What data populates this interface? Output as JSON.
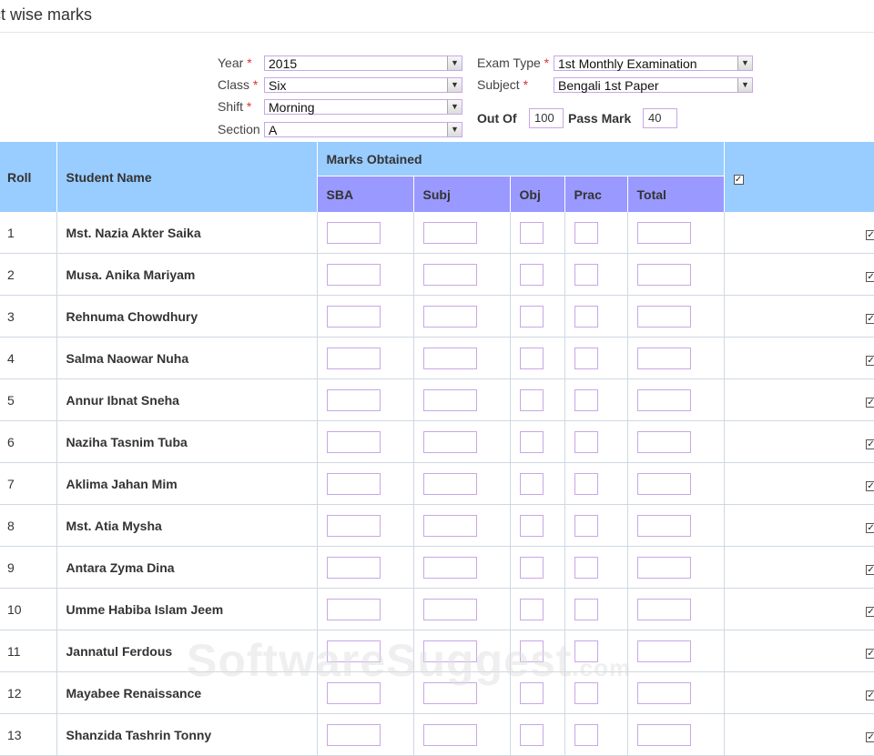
{
  "page": {
    "title": "ct wise marks"
  },
  "filters": {
    "year": {
      "label": "Year",
      "required": "*",
      "value": "2015"
    },
    "class": {
      "label": "Class",
      "required": "*",
      "value": "Six"
    },
    "shift": {
      "label": "Shift",
      "required": "*",
      "value": "Morning"
    },
    "section": {
      "label": "Section",
      "value": "A"
    },
    "exam_type": {
      "label": "Exam Type",
      "required": "*",
      "value": "1st Monthly Examination"
    },
    "subject": {
      "label": "Subject",
      "required": "*",
      "value": "Bengali 1st Paper"
    },
    "out_of": {
      "label": "Out Of",
      "value": "100"
    },
    "pass_mark": {
      "label": "Pass Mark",
      "value": "40"
    }
  },
  "table": {
    "headers": {
      "roll": "Roll",
      "student_name": "Student Name",
      "marks_obtained": "Marks Obtained"
    },
    "sub_headers": {
      "sba": "SBA",
      "subj": "Subj",
      "obj": "Obj",
      "prac": "Prac",
      "total": "Total"
    },
    "select_all_checked": true,
    "rows": [
      {
        "roll": "1",
        "name": "Mst. Nazia Akter Saika",
        "checked": true
      },
      {
        "roll": "2",
        "name": "Musa. Anika Mariyam",
        "checked": true
      },
      {
        "roll": "3",
        "name": "Rehnuma Chowdhury",
        "checked": true
      },
      {
        "roll": "4",
        "name": "Salma Naowar Nuha",
        "checked": true
      },
      {
        "roll": "5",
        "name": "Annur Ibnat Sneha",
        "checked": true
      },
      {
        "roll": "6",
        "name": "Naziha Tasnim Tuba",
        "checked": true
      },
      {
        "roll": "7",
        "name": "Aklima Jahan Mim",
        "checked": true
      },
      {
        "roll": "8",
        "name": "Mst. Atia Mysha",
        "checked": true
      },
      {
        "roll": "9",
        "name": "Antara Zyma Dina",
        "checked": true
      },
      {
        "roll": "10",
        "name": "Umme Habiba Islam Jeem",
        "checked": true
      },
      {
        "roll": "11",
        "name": "Jannatul Ferdous",
        "checked": true
      },
      {
        "roll": "12",
        "name": "Mayabee Renaissance",
        "checked": true
      },
      {
        "roll": "13",
        "name": "Shanzida Tashrin Tonny",
        "checked": true
      }
    ]
  },
  "watermark": {
    "main": "SoftwareSuggest",
    "suffix": ".com"
  },
  "icons": {
    "dropdown": "chevron-down-icon",
    "check": "check-icon"
  },
  "colors": {
    "header_bg": "#99ccff",
    "subheader_bg": "#9999ff",
    "input_border": "#c9a6e6",
    "required": "#e03030"
  }
}
